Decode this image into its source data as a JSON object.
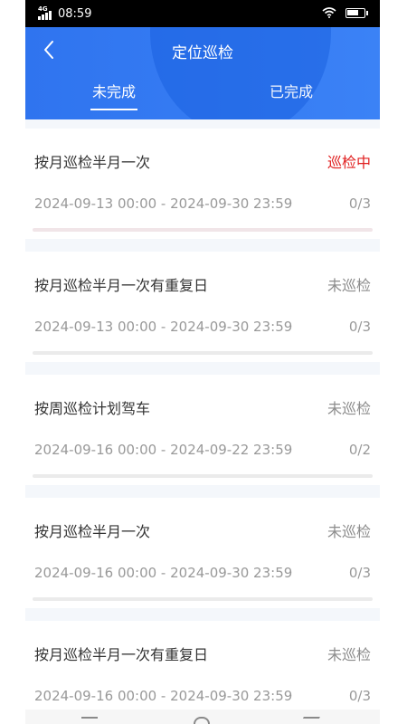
{
  "status_bar": {
    "network": "4G",
    "time": "08:59"
  },
  "header": {
    "title": "定位巡检",
    "back_icon": "chevron-left-icon",
    "tabs": [
      {
        "label": "未完成",
        "active": true
      },
      {
        "label": "已完成",
        "active": false
      }
    ]
  },
  "colors": {
    "header_blue": "#2f74ef",
    "active_status_red": "#e02020",
    "muted_gray": "#999999"
  },
  "tasks": [
    {
      "name": "按月巡检半月一次",
      "status": "巡检中",
      "time_range": "2024-09-13 00:00 - 2024-09-30 23:59",
      "progress": "0/3"
    },
    {
      "name": "按月巡检半月一次有重复日",
      "status": "未巡检",
      "time_range": "2024-09-13 00:00 - 2024-09-30 23:59",
      "progress": "0/3"
    },
    {
      "name": "按周巡检计划驾车",
      "status": "未巡检",
      "time_range": "2024-09-16 00:00 - 2024-09-22 23:59",
      "progress": "0/2"
    },
    {
      "name": "按月巡检半月一次",
      "status": "未巡检",
      "time_range": "2024-09-16 00:00 - 2024-09-30 23:59",
      "progress": "0/3"
    },
    {
      "name": "按月巡检半月一次有重复日",
      "status": "未巡检",
      "time_range": "2024-09-16 00:00 - 2024-09-30 23:59",
      "progress": "0/3"
    }
  ]
}
